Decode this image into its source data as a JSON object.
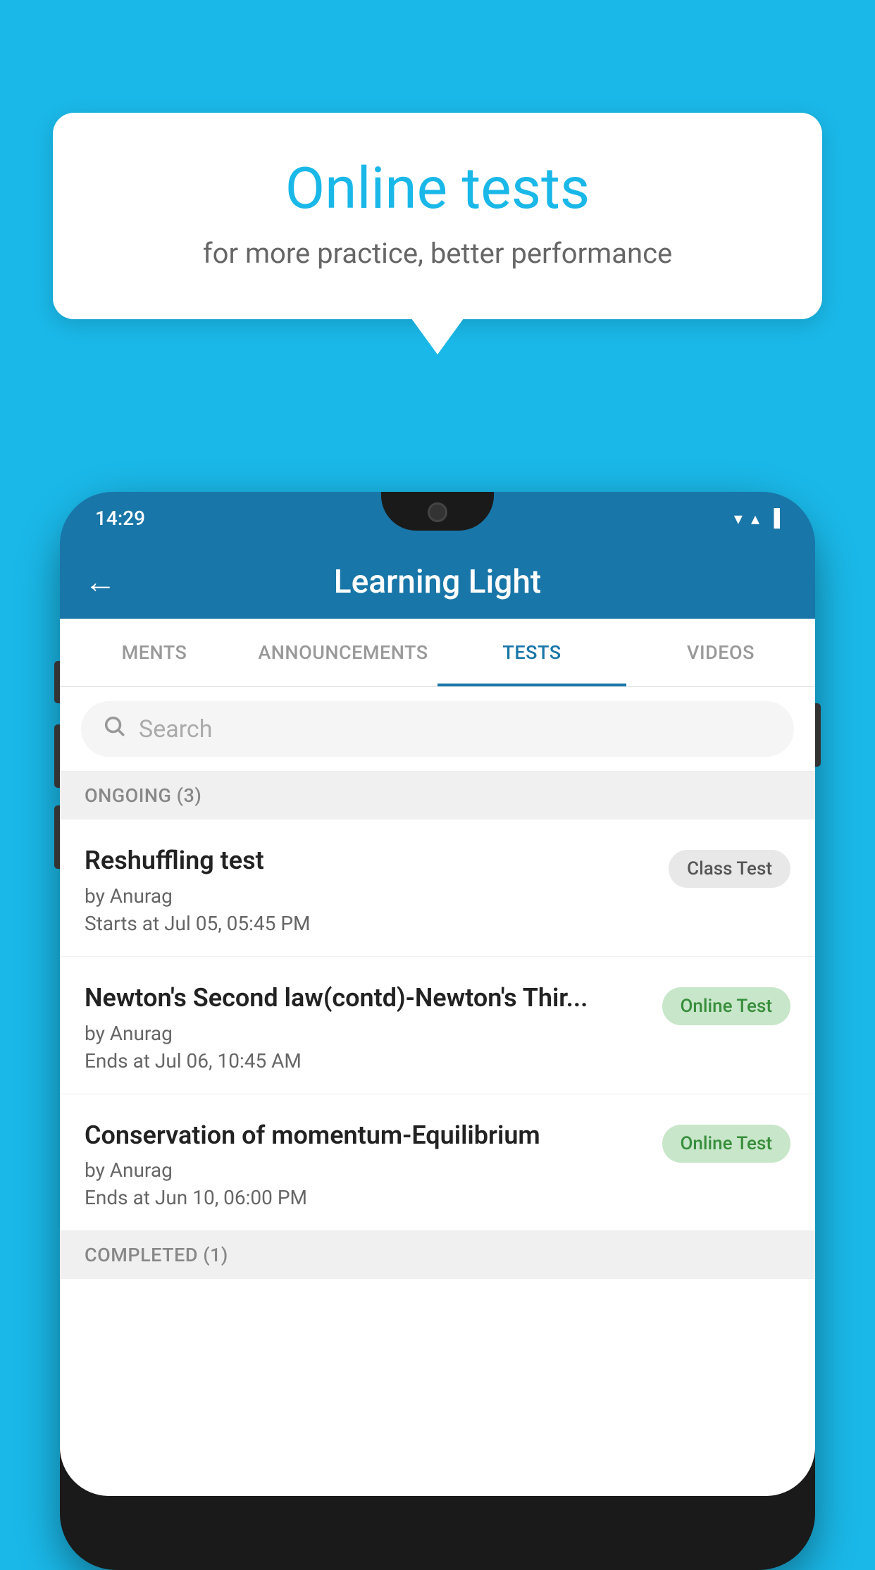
{
  "background_color": "#1ab8e8",
  "bubble": {
    "title": "Online tests",
    "subtitle": "for more practice, better performance"
  },
  "status_bar": {
    "time": "14:29",
    "wifi_icon": "▼",
    "signal_icon": "▲",
    "battery_icon": "▌"
  },
  "app_bar": {
    "back_label": "←",
    "title": "Learning Light"
  },
  "tabs": [
    {
      "label": "MENTS",
      "active": false
    },
    {
      "label": "ANNOUNCEMENTS",
      "active": false
    },
    {
      "label": "TESTS",
      "active": true
    },
    {
      "label": "VIDEOS",
      "active": false
    }
  ],
  "search": {
    "placeholder": "Search"
  },
  "ongoing_section": {
    "label": "ONGOING (3)"
  },
  "test_items": [
    {
      "name": "Reshuffling test",
      "author": "by Anurag",
      "time_label": "Starts at",
      "time": "Jul 05, 05:45 PM",
      "badge": "Class Test",
      "badge_type": "gray"
    },
    {
      "name": "Newton's Second law(contd)-Newton's Thir...",
      "author": "by Anurag",
      "time_label": "Ends at",
      "time": "Jul 06, 10:45 AM",
      "badge": "Online Test",
      "badge_type": "green"
    },
    {
      "name": "Conservation of momentum-Equilibrium",
      "author": "by Anurag",
      "time_label": "Ends at",
      "time": "Jun 10, 06:00 PM",
      "badge": "Online Test",
      "badge_type": "green"
    }
  ],
  "completed_section": {
    "label": "COMPLETED (1)"
  }
}
